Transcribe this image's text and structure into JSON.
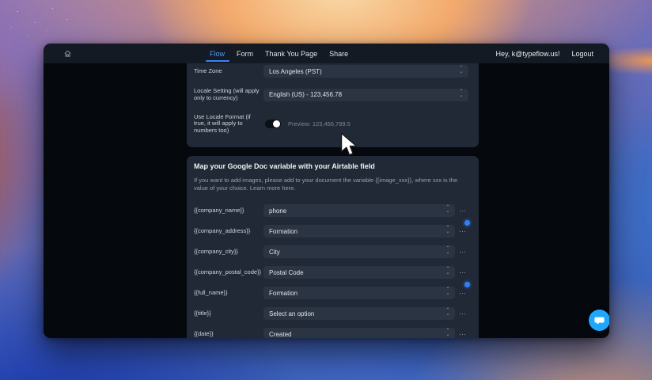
{
  "header": {
    "greeting": "Hey, k@typeflow.us!",
    "logout": "Logout",
    "tabs": [
      {
        "label": "Flow",
        "active": true
      },
      {
        "label": "Form",
        "active": false
      },
      {
        "label": "Thank You Page",
        "active": false
      },
      {
        "label": "Share",
        "active": false
      }
    ]
  },
  "settings": {
    "timezone": {
      "label": "Time Zone",
      "value": "Los Angeles (PST)"
    },
    "locale": {
      "label": "Locale Setting (will apply only to currency)",
      "value": "English (US) - 123,456.78"
    },
    "locale_format": {
      "label": "Use Locale Format (if true, it will apply to numbers too)",
      "toggle_on": true,
      "preview": "Preview: 123,456,789.5"
    }
  },
  "mapping": {
    "title": "Map your Google Doc variable with your Airtable field",
    "description": "If you want to add images, please add to your document the variable {{image_xxx}}, where xxx is the value of your choice. Learn more here.",
    "rows": [
      {
        "variable": "{{company_name}}",
        "value": "phone",
        "badge": false
      },
      {
        "variable": "{{company_address}}",
        "value": "Formation",
        "badge": true
      },
      {
        "variable": "{{company_city}}",
        "value": "City",
        "badge": false
      },
      {
        "variable": "{{company_postal_code}}",
        "value": "Postal Code",
        "badge": false
      },
      {
        "variable": "{{full_name}}",
        "value": "Formation",
        "badge": true
      },
      {
        "variable": "{{title}}",
        "value": "Select an option",
        "badge": false
      },
      {
        "variable": "{{date}}",
        "value": "Created",
        "badge": false
      }
    ]
  },
  "icons": {
    "more_options": "⋯"
  },
  "colors": {
    "accent_blue": "#4f9cf8",
    "badge_blue": "#2f80f5",
    "chat_blue": "#1ea7fd"
  }
}
